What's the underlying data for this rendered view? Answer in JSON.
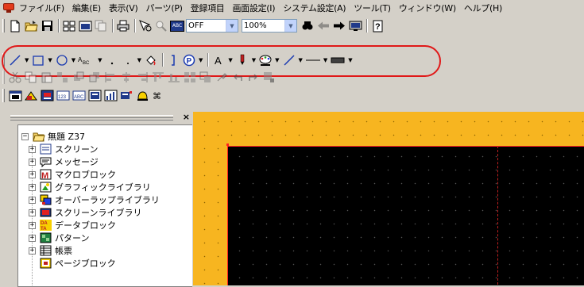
{
  "menu": {
    "items": [
      "ファイル(F)",
      "編集(E)",
      "表示(V)",
      "パーツ(P)",
      "登録項目",
      "画面設定(I)",
      "システム設定(A)",
      "ツール(T)",
      "ウィンドウ(W)",
      "ヘルプ(H)"
    ]
  },
  "toolbar_standard": {
    "overlap_label": "OFF",
    "zoom_value": "100%"
  },
  "toolbar_draw": {
    "text_tool_label": "A",
    "subscript_label": "ABC",
    "circle_p_label": "P"
  },
  "panel": {
    "close_label": "×",
    "root": "無題 Z37",
    "items": [
      "スクリーン",
      "メッセージ",
      "マクロブロック",
      "グラフィックライブラリ",
      "オーバーラップライブラリ",
      "スクリーンライブラリ",
      "データブロック",
      "パターン",
      "帳票",
      "ページブロック"
    ]
  },
  "colors": {
    "highlight": "#e01818",
    "canvas_background": "#f7b520",
    "screen_area": "#000000",
    "screen_border": "#ff2020"
  }
}
